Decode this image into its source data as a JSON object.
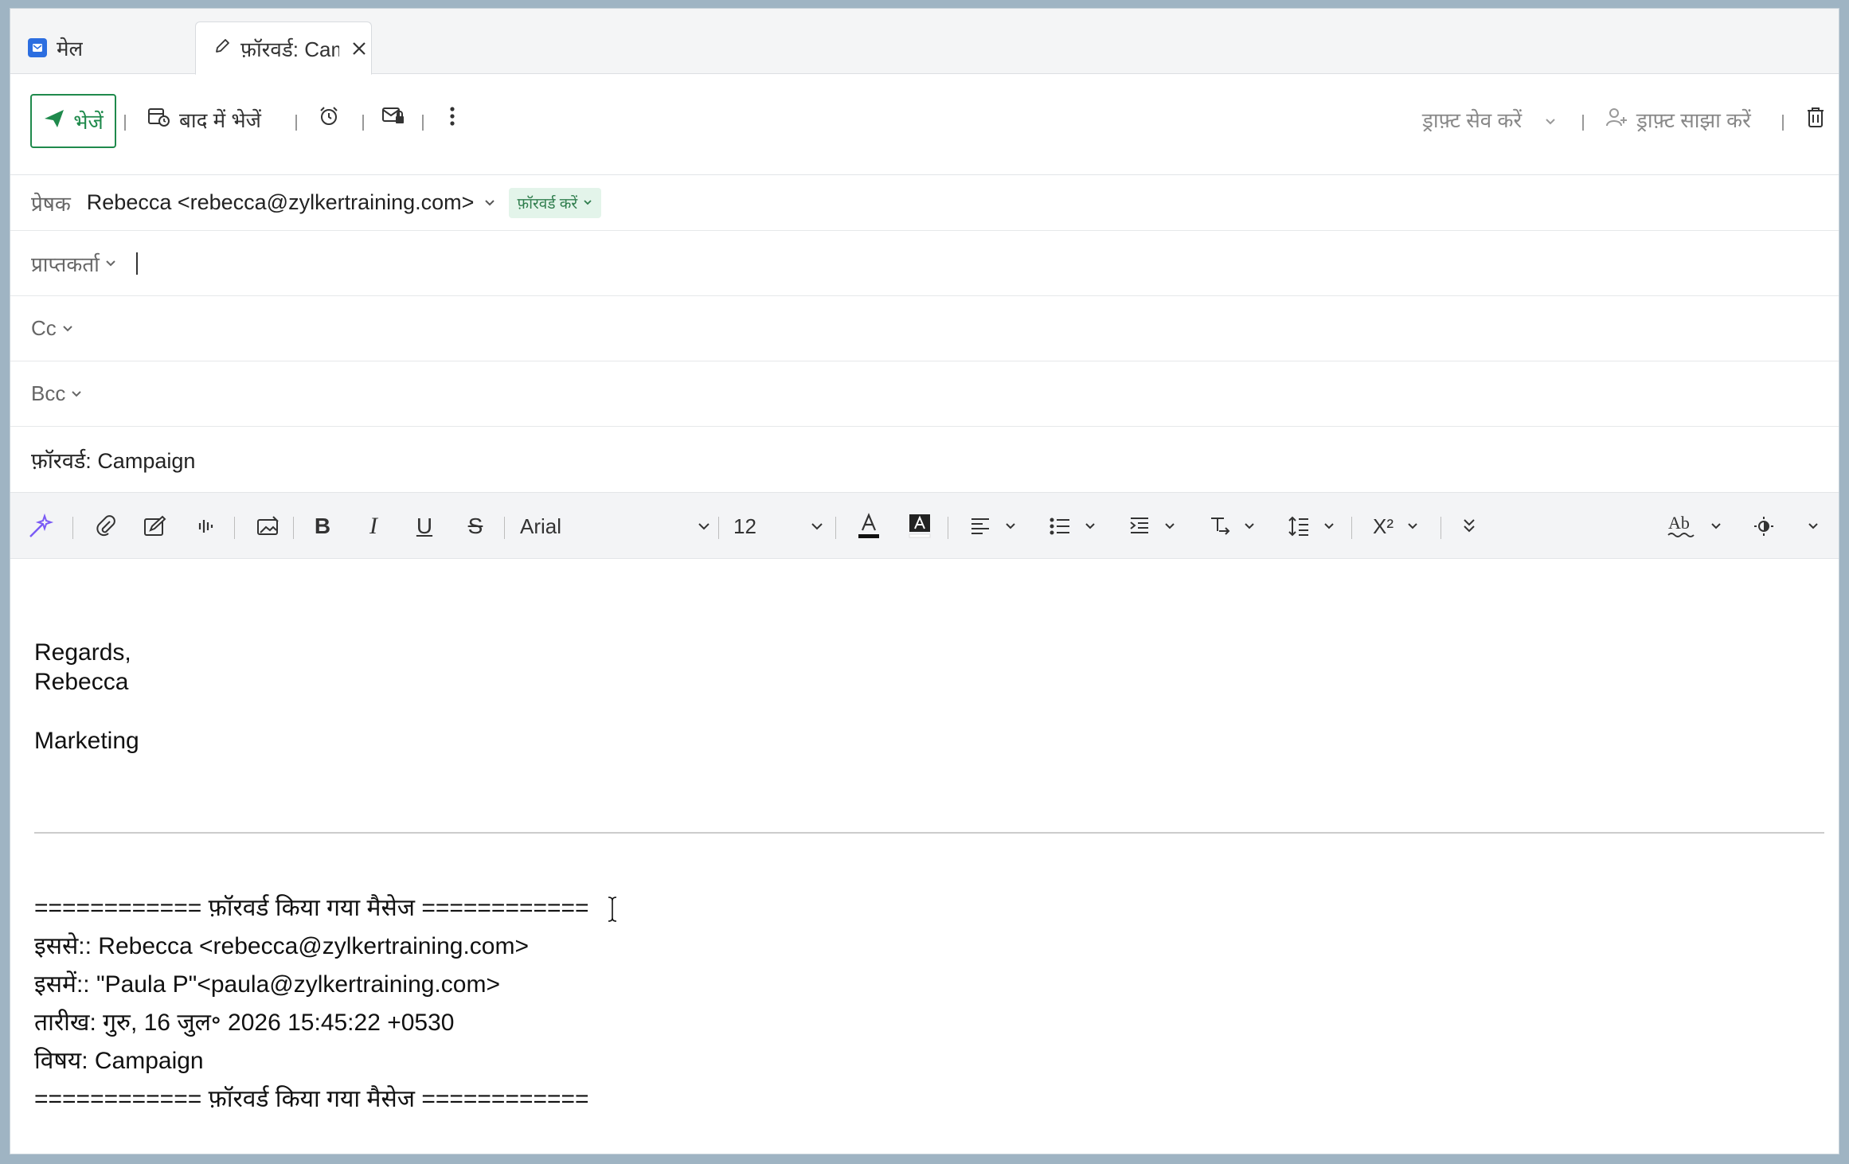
{
  "tabs": [
    {
      "label": "मेल"
    },
    {
      "label": "फ़ॉरवर्ड: Campaign"
    }
  ],
  "toolbar": {
    "send_label": "भेजें",
    "send_later_label": "बाद में भेजें",
    "save_draft_label": "ड्राफ़्ट सेव करें",
    "share_draft_label": "ड्राफ़्ट साझा करें"
  },
  "fields": {
    "from_label": "प्रेषक",
    "from_value": "Rebecca <rebecca@zylkertraining.com>",
    "forward_badge": "फ़ॉरवर्ड करें",
    "to_label": "प्राप्तकर्ता",
    "cc_label": "Cc",
    "bcc_label": "Bcc",
    "subject": "फ़ॉरवर्ड: Campaign"
  },
  "editor": {
    "font": "Arial",
    "size": "12"
  },
  "body": {
    "line1": "Regards,",
    "line2": "Rebecca",
    "line3": "Marketing"
  },
  "forwarded": {
    "header_line": "============ फ़ॉरवर्ड किया गया मैसेज ============",
    "from": "इससे:: Rebecca <rebecca@zylkertraining.com>",
    "to": "इसमें:: \"Paula P\"<paula@zylkertraining.com>",
    "date": "तारीख: गुरु, 16 जुल॰ 2026 15:45:22 +0530",
    "subject": "विषय: Campaign",
    "footer_line": "============ फ़ॉरवर्ड किया गया मैसेज ============"
  },
  "colors": {
    "accent_green": "#1f8a4c",
    "badge_bg": "#e3f4ea",
    "mail_icon_blue": "#2c6ee0"
  }
}
